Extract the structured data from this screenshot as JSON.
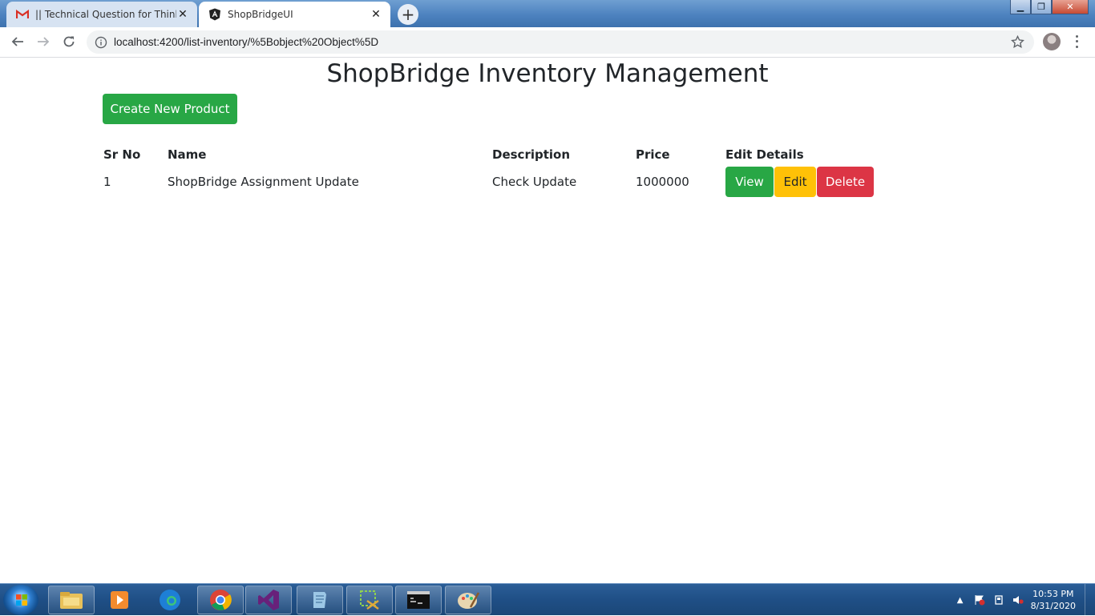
{
  "browser": {
    "tabs": [
      {
        "title": "|| Technical Question for Thinkbri",
        "icon": "gmail-icon"
      },
      {
        "title": "ShopBridgeUI",
        "icon": "angular-icon"
      }
    ],
    "url": "localhost:4200/list-inventory/%5Bobject%20Object%5D"
  },
  "page": {
    "title": "ShopBridge Inventory Management",
    "create_button": "Create New Product",
    "table": {
      "headers": [
        "Sr No",
        "Name",
        "Description",
        "Price",
        "Edit Details"
      ],
      "rows": [
        {
          "sr_no": "1",
          "name": "ShopBridge Assignment Update",
          "description": "Check Update",
          "price": "1000000"
        }
      ],
      "actions": {
        "view": "View",
        "edit": "Edit",
        "delete": "Delete"
      }
    },
    "colors": {
      "success": "#28a745",
      "warning": "#ffc107",
      "danger": "#dc3545"
    }
  },
  "taskbar": {
    "time": "10:53 PM",
    "date": "8/31/2020",
    "apps": [
      "file-explorer-icon",
      "media-player-icon",
      "edge-icon",
      "chrome-icon",
      "visual-studio-icon",
      "notepad-icon",
      "snipping-tool-icon",
      "command-prompt-icon",
      "paint-icon"
    ]
  }
}
